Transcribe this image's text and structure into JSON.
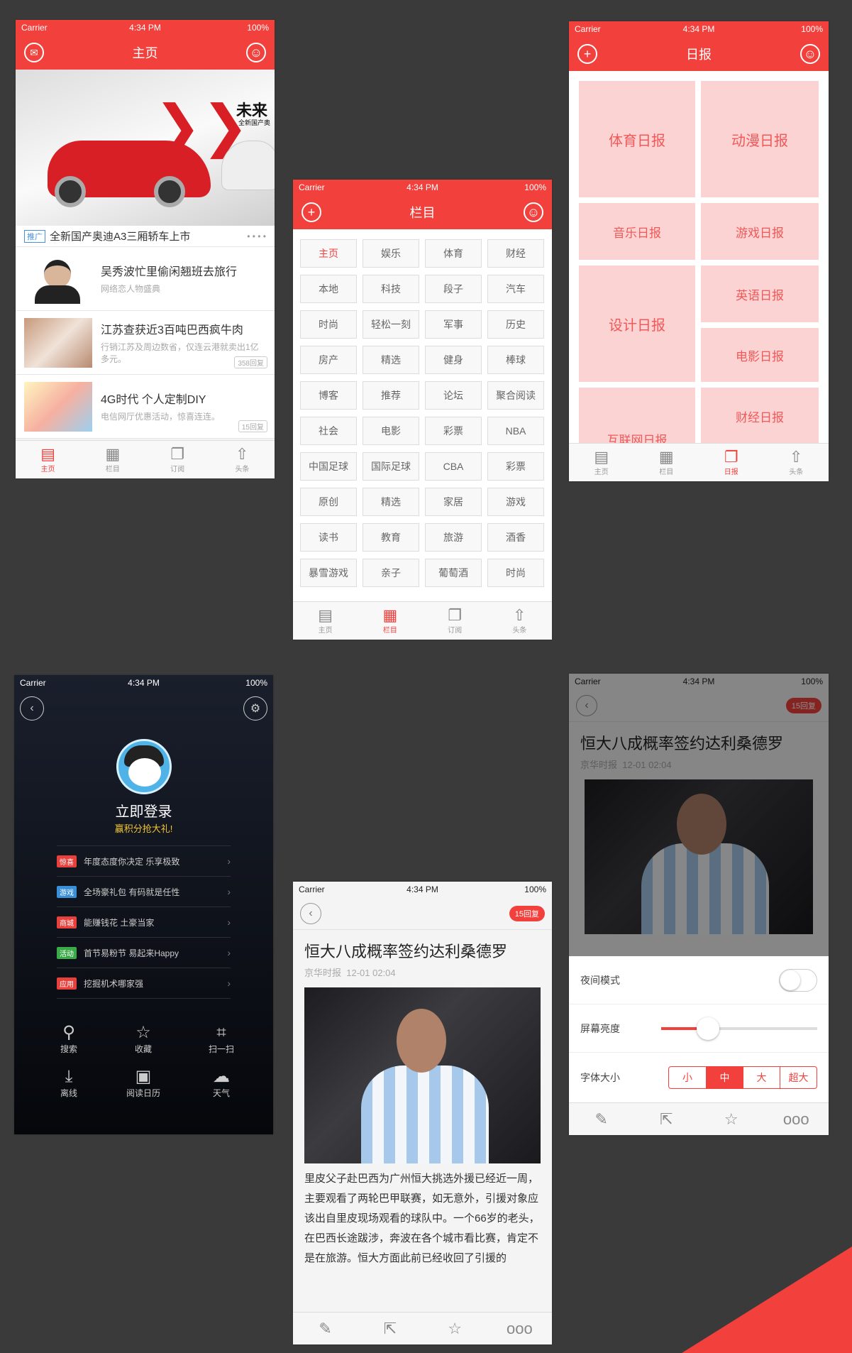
{
  "status": {
    "carrier": "Carrier",
    "time": "4:34 PM",
    "battery": "100%"
  },
  "phone1": {
    "title": "主页",
    "ad": {
      "tag": "推广",
      "text": "全新国产奥迪A3三厢轿车上市",
      "brand": "未来",
      "brand_sub": "全新国产奥"
    },
    "news": [
      {
        "title": "吴秀波忙里偷闲翘班去旅行",
        "sub": "网络恋人物盛典",
        "count": ""
      },
      {
        "title": "江苏查获近3百吨巴西疯牛肉",
        "sub": "行销江苏及周边数省，仅连云港就卖出1亿多元。",
        "count": "358回复"
      },
      {
        "title": "4G时代 个人定制DIY",
        "sub": "电信网厅优惠活动，惊喜连连。",
        "count": "15回复"
      }
    ],
    "tabs": [
      {
        "icon": "home-icon",
        "label": "主页"
      },
      {
        "icon": "grid-icon",
        "label": "栏目"
      },
      {
        "icon": "subscribe-icon",
        "label": "订阅"
      },
      {
        "icon": "headline-icon",
        "label": "头条"
      }
    ]
  },
  "phone2": {
    "title": "栏目",
    "cells": [
      "主页",
      "娱乐",
      "体育",
      "财经",
      "本地",
      "科技",
      "段子",
      "汽车",
      "时尚",
      "轻松一刻",
      "军事",
      "历史",
      "房产",
      "精选",
      "健身",
      "棒球",
      "博客",
      "推荐",
      "论坛",
      "聚合阅读",
      "社会",
      "电影",
      "彩票",
      "NBA",
      "中国足球",
      "国际足球",
      "CBA",
      "彩票",
      "原创",
      "精选",
      "家居",
      "游戏",
      "读书",
      "教育",
      "旅游",
      "酒香",
      "暴雪游戏",
      "亲子",
      "葡萄酒",
      "时尚"
    ],
    "tabs": [
      {
        "label": "主页"
      },
      {
        "label": "栏目"
      },
      {
        "label": "订阅"
      },
      {
        "label": "头条"
      }
    ]
  },
  "phone3": {
    "title": "日报",
    "tiles": [
      "体育日报",
      "动漫日报",
      "音乐日报",
      "游戏日报",
      "设计日报",
      "英语日报",
      "电影日报",
      "财经日报",
      "互联网日报"
    ],
    "tabs": [
      {
        "label": "主页"
      },
      {
        "label": "栏目"
      },
      {
        "label": "日报"
      },
      {
        "label": "头条"
      }
    ]
  },
  "phone4": {
    "login": "立即登录",
    "login_sub": "赢积分抢大礼!",
    "menu": [
      {
        "tag": "惊喜",
        "tag_color": "#e8403c",
        "text": "年度态度你决定 乐享极致"
      },
      {
        "tag": "游戏",
        "tag_color": "#3a8fd9",
        "text": "全场豪礼包 有码就是任性"
      },
      {
        "tag": "商城",
        "tag_color": "#e8403c",
        "text": "能赚钱花 土豪当家"
      },
      {
        "tag": "活动",
        "tag_color": "#3bab4a",
        "text": "首节易粉节 易起来Happy"
      },
      {
        "tag": "应用",
        "tag_color": "#e8403c",
        "text": "挖掘机术哪家强"
      }
    ],
    "grid": [
      {
        "icon": "search-icon",
        "label": "搜索"
      },
      {
        "icon": "star-icon",
        "label": "收藏"
      },
      {
        "icon": "scan-icon",
        "label": "扫一扫"
      },
      {
        "icon": "download-icon",
        "label": "离线"
      },
      {
        "icon": "calendar-icon",
        "label": "阅读日历"
      },
      {
        "icon": "cloud-icon",
        "label": "天气"
      }
    ]
  },
  "article": {
    "title": "恒大八成概率签约达利桑德罗",
    "source": "京华时报",
    "date": "12-01 02:04",
    "replies": "15回复",
    "body": "里皮父子赴巴西为广州恒大挑选外援已经近一周，主要观看了两轮巴甲联赛，如无意外，引援对象应该出自里皮现场观看的球队中。一个66岁的老头，在巴西长途跋涉，奔波在各个城市看比赛，肯定不是在旅游。恒大方面此前已经收回了引援的"
  },
  "settings": {
    "night_label": "夜间模式",
    "brightness_label": "屏幕亮度",
    "brightness": 0.3,
    "font_label": "字体大小",
    "font_options": [
      "小",
      "中",
      "大",
      "超大"
    ],
    "font_selected": "中"
  },
  "colors": {
    "accent": "#f2403c",
    "bg": "#3a3a3a",
    "tile": "#fbd3d3"
  }
}
